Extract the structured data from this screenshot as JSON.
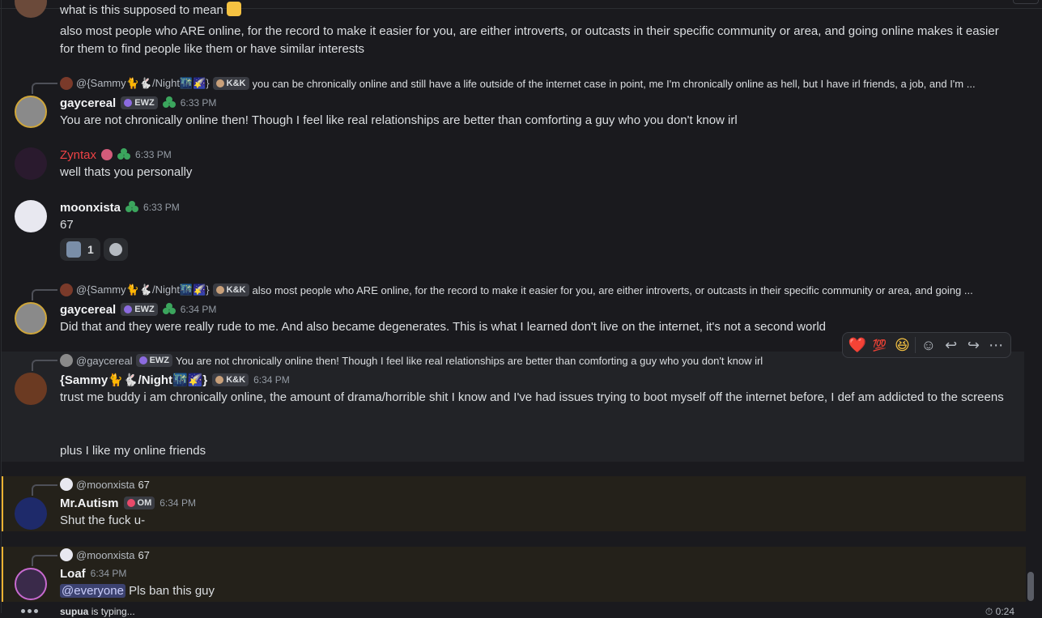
{
  "messages": {
    "m0": {
      "line1": "what is this supposed to mean",
      "line2": "also most people who ARE online, for the record to make it easier for you, are either introverts, or outcasts in their specific community or area, and going online makes it easier for them to find people like them or have similar interests"
    },
    "m1": {
      "reply_name": "@{Sammy🐈🐇/Night🌃🌠}",
      "reply_tag": "K&K",
      "reply_text": "you can be chronically online and still have a life outside of the internet case in point, me I'm chronically online as hell, but I have irl friends, a job, and I'm ...",
      "name": "gaycereal",
      "tag": "EWZ",
      "time": "6:33 PM",
      "text": "You are not chronically online then! Though I feel like real relationships are better than comforting a guy who you don't know irl"
    },
    "m2": {
      "name": "Zyntax",
      "time": "6:33 PM",
      "text": "well thats you personally"
    },
    "m3": {
      "name": "moonxista",
      "time": "6:33 PM",
      "text": "67",
      "reaction_count": "1"
    },
    "m4": {
      "reply_name": "@{Sammy🐈🐇/Night🌃🌠}",
      "reply_tag": "K&K",
      "reply_text": "also most people who ARE online, for the record to make it easier for you, are either introverts, or outcasts in their specific community or area, and going ...",
      "name": "gaycereal",
      "tag": "EWZ",
      "time": "6:34 PM",
      "text": "Did that and they were really rude to me. And also became degenerates. This is what I learned don't live on the internet, it's not a second world"
    },
    "m5": {
      "reply_name": "@gaycereal",
      "reply_tag": "EWZ",
      "reply_text": "You are not chronically online then! Though I feel like real relationships are better than comforting a guy who you don't know irl",
      "name": "{Sammy🐈🐇/Night🌃🌠}",
      "tag": "K&K",
      "time": "6:34 PM",
      "text1": "trust me buddy i am chronically online, the amount of drama/horrible shit I know and I've had issues trying to boot myself off the internet before, I def am addicted to the screens",
      "text2": "plus I like my online friends"
    },
    "m6": {
      "reply_name": "@moonxista",
      "reply_text": "67",
      "name": "Mr.Autism",
      "tag": "OM",
      "time": "6:34 PM",
      "text": "Shut the fuck u-"
    },
    "m7": {
      "reply_name": "@moonxista",
      "reply_text": "67",
      "name": "Loaf",
      "time": "6:34 PM",
      "mention": "@everyone",
      "text": "Pls ban this guy"
    }
  },
  "toolbar": {
    "reactions": [
      "❤️",
      "💯",
      "😆"
    ]
  },
  "typing": {
    "user": "supua",
    "suffix": "is typing..."
  },
  "timer": "0:24",
  "colors": {
    "background": "#1a1a1e",
    "mention_highlight": "#f0b232",
    "zyntax_name": "#ed4245"
  }
}
